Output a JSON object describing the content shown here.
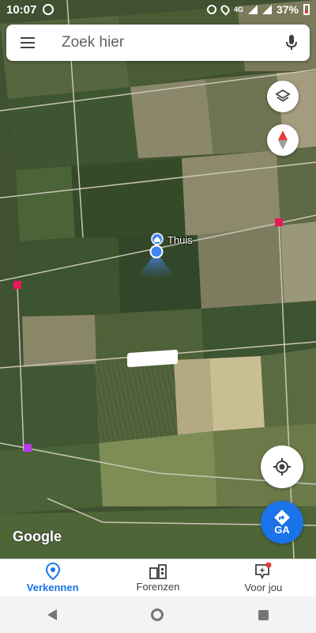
{
  "status_bar": {
    "time": "10:07",
    "network": "4G",
    "battery_percent": "37%"
  },
  "search": {
    "placeholder": "Zoek hier"
  },
  "map": {
    "place_label": "Thuis",
    "logo_text": "Google"
  },
  "go_button": {
    "label": "GA"
  },
  "bottom_nav": {
    "items": [
      {
        "label": "Verkennen",
        "active": true
      },
      {
        "label": "Forenzen",
        "active": false
      },
      {
        "label": "Voor jou",
        "active": false
      }
    ]
  },
  "colors": {
    "accent": "#1a73e8",
    "marker_red": "#e6195a",
    "marker_purple": "#b43ce6"
  },
  "icons": {
    "menu": "menu-icon",
    "mic": "mic-icon",
    "layers": "layers-icon",
    "compass": "compass-icon",
    "locate": "my-location-icon",
    "directions": "directions-icon"
  }
}
